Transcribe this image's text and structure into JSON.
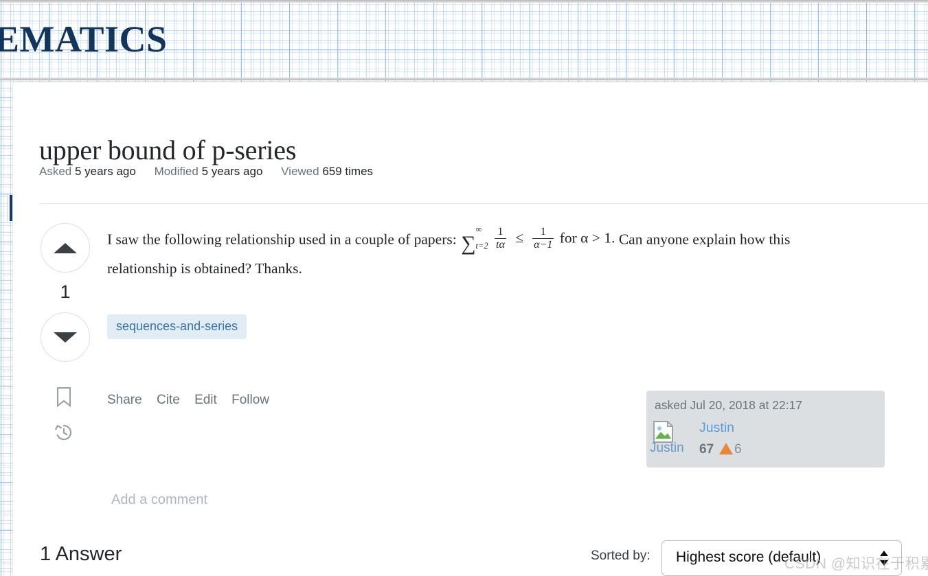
{
  "site": {
    "masthead_text": "EMATICS",
    "masthead_color": "#12355b"
  },
  "question": {
    "title": "upper bound of p-series",
    "meta": {
      "asked_label": "Asked",
      "asked_value": "5 years ago",
      "modified_label": "Modified",
      "modified_value": "5 years ago",
      "viewed_label": "Viewed",
      "viewed_value": "659 times"
    },
    "vote": {
      "up_icon": "triangle-up-icon",
      "down_icon": "triangle-down-icon",
      "score": "1",
      "bookmark_icon": "bookmark-icon",
      "history_icon": "history-icon"
    },
    "body": {
      "text_before_math": "I saw the following relationship used in a couple of papers:",
      "math": {
        "sum_sign": "∑",
        "sum_upper": "∞",
        "sum_lower": "t=2",
        "first_fraction_num": "1",
        "first_fraction_den": "tα",
        "relation": "≤",
        "second_fraction_num": "1",
        "second_fraction_den": "α−1",
        "condition": "for α > 1.",
        "plain": "∑ from t=2 to ∞ of 1/t^α ≤ 1/(α−1) for α > 1."
      },
      "text_after_math": "Can anyone explain how this relationship is obtained? Thanks."
    },
    "tags": [
      "sequences-and-series"
    ],
    "actions": [
      "Share",
      "Cite",
      "Edit",
      "Follow"
    ],
    "user_card": {
      "action_time": "asked Jul 20, 2018 at 22:17",
      "avatar_icon": "broken-image-icon",
      "avatar_alt_text": "Justin",
      "username": "Justin",
      "reputation": "67",
      "bronze_badge_icon": "bronze-badge-icon",
      "bronze_badge_count": "6"
    },
    "add_comment_label": "Add a comment"
  },
  "answers": {
    "heading": "1 Answer",
    "sort_label": "Sorted by:",
    "sort_selected": "Highest score (default)",
    "sort_icon": "updown-arrows-icon"
  },
  "watermark": {
    "text": "CSDN @知识在于积累"
  },
  "colors": {
    "tag_bg": "#e1ecf4",
    "tag_text": "#39739d",
    "link_blue": "#5b9dd9",
    "badge_bronze": "#e8883a",
    "user_card_bg": "#dcdfe2"
  }
}
